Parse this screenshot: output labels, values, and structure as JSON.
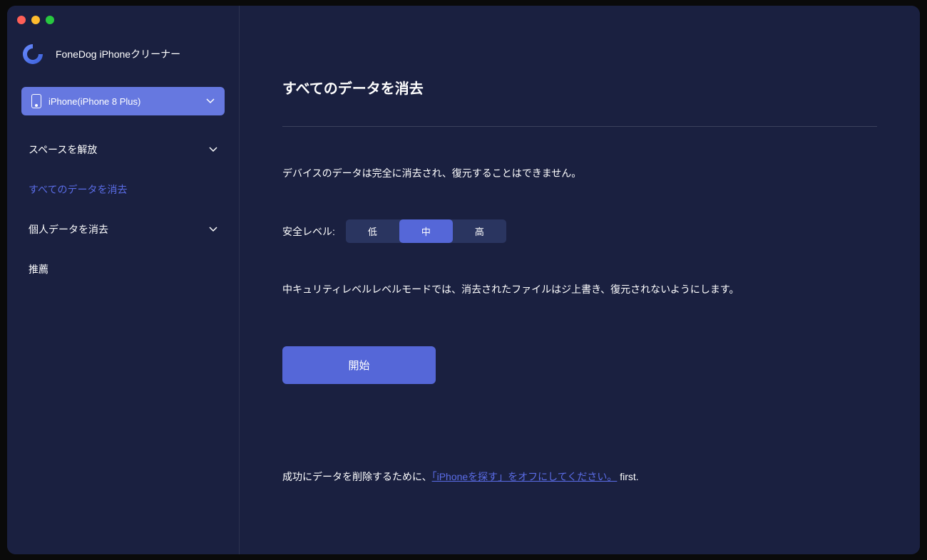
{
  "app": {
    "title": "FoneDog iPhoneクリーナー"
  },
  "device": {
    "label": "iPhone(iPhone 8 Plus)"
  },
  "sidebar": {
    "items": [
      {
        "label": "スペースを解放",
        "hasChevron": true
      },
      {
        "label": "すべてのデータを消去",
        "hasChevron": false,
        "active": true
      },
      {
        "label": "個人データを消去",
        "hasChevron": true
      },
      {
        "label": "推薦",
        "hasChevron": false
      }
    ]
  },
  "main": {
    "title": "すべてのデータを消去",
    "warning": "デバイスのデータは完全に消去され、復元することはできません。",
    "levelLabel": "安全レベル:",
    "levels": [
      {
        "label": "低",
        "active": false
      },
      {
        "label": "中",
        "active": true
      },
      {
        "label": "高",
        "active": false
      }
    ],
    "levelDescription": "中キュリティレベルレベルモードでは、消去されたファイルはジ上書き、復元されないようにします。",
    "startButton": "開始",
    "footer": {
      "prefix": "成功にデータを削除するために、",
      "link": "「iPhoneを探す」をオフにしてください。",
      "suffix": " first."
    }
  }
}
